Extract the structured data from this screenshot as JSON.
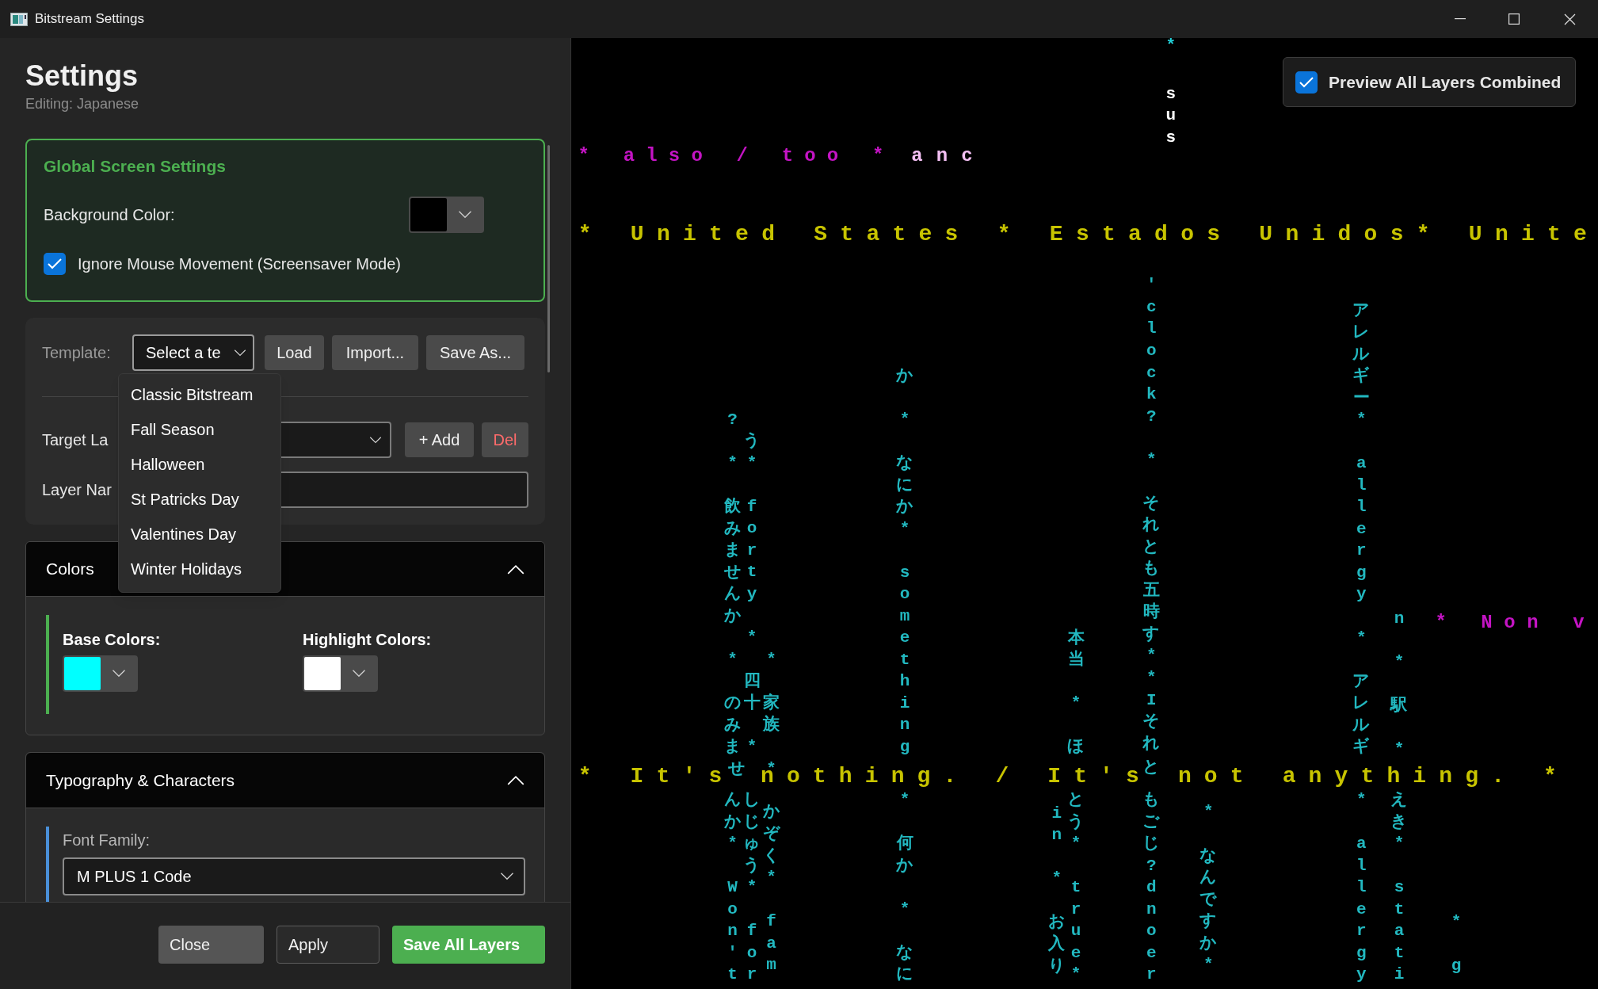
{
  "window": {
    "title": "Bitstream Settings"
  },
  "settings": {
    "heading": "Settings",
    "subtitle": "Editing: Japanese",
    "global": {
      "title": "Global Screen Settings",
      "background": {
        "label": "Background Color:",
        "color": "#000000"
      },
      "ignore_mouse": {
        "label": "Ignore Mouse Movement (Screensaver Mode)",
        "checked": true
      }
    },
    "template": {
      "label": "Template:",
      "value": "Select a te",
      "expanded": true,
      "buttons": [
        "Load",
        "Import...",
        "Save As..."
      ],
      "options": [
        "Classic Bitstream",
        "Fall Season",
        "Halloween",
        "St Patricks Day",
        "Valentines Day",
        "Winter Holidays"
      ]
    },
    "target_layer": {
      "label": "Target La",
      "buttons": [
        {
          "label": "+ Add",
          "kind": "normal"
        },
        {
          "label": "Del",
          "kind": "danger"
        }
      ]
    },
    "layer_name": {
      "label": "Layer Nar"
    },
    "colors": {
      "title": "Colors",
      "expanded": true,
      "pickers": [
        {
          "label": "Base Colors:",
          "color": "#00ffff"
        },
        {
          "label": "Highlight Colors:",
          "color": "#ffffff"
        }
      ]
    },
    "typography": {
      "title": "Typography & Characters",
      "expanded": true,
      "font_family": {
        "label": "Font Family:",
        "value": "M PLUS 1 Code"
      }
    }
  },
  "footer_buttons": [
    {
      "label": "Close",
      "kind": "secondary"
    },
    {
      "label": "Apply",
      "kind": "outline"
    },
    {
      "label": "Save All Layers",
      "kind": "primary"
    }
  ],
  "preview": {
    "combine_toggle": {
      "label": "Preview All Layers Combined",
      "checked": true
    },
    "streams": [
      {
        "kind": "vertical",
        "text": "*",
        "color": "#22d0d8"
      },
      {
        "kind": "vertical",
        "text": "sus",
        "color": "#ffffff"
      },
      {
        "kind": "horizontal",
        "text": "* also / too *",
        "color": "#c414c4"
      },
      {
        "kind": "horizontal",
        "text": "anc",
        "color": "#f4c0f4"
      },
      {
        "kind": "horizontal",
        "text": "* United States * Estados Unidos* Unite",
        "color": "#c8c400"
      },
      {
        "kind": "vertical",
        "text": "? * 飲みませんか * のみま",
        "color": "#22b8c0"
      },
      {
        "kind": "vertical",
        "text": "う* forty * 四十 *",
        "color": "#22b8c0"
      },
      {
        "kind": "vertical",
        "text": "* 家族",
        "color": "#22b8c0"
      },
      {
        "kind": "vertical",
        "text": "か * なにか* something",
        "color": "#22b8c0"
      },
      {
        "kind": "vertical",
        "text": "本当 * ほ",
        "color": "#22b8c0"
      },
      {
        "kind": "vertical",
        "text": "'clock? * それとも五時す**Iそれ",
        "color": "#22b8c0"
      },
      {
        "kind": "vertical",
        "text": "アレルギー* allergy * アレルギ",
        "color": "#22b8c0"
      },
      {
        "kind": "vertical",
        "text": "n * 駅 *",
        "color": "#22b8c0"
      },
      {
        "kind": "horizontal",
        "text": "* Non v",
        "color": "#c414c4"
      },
      {
        "kind": "horizontal",
        "text": "* It's",
        "color": "#c8c400"
      },
      {
        "kind": "vertical",
        "text": "せ",
        "color": "#22b8c0"
      },
      {
        "kind": "vertical",
        "text": "*",
        "color": "#22b8c0"
      },
      {
        "kind": "horizontal",
        "text": "nothing. / It's not anything. *",
        "color": "#c8c400"
      },
      {
        "kind": "vertical",
        "text": "と",
        "color": "#22b8c0"
      },
      {
        "kind": "vertical",
        "text": "んか* Won't",
        "color": "#22b8c0"
      },
      {
        "kind": "vertical",
        "text": "しじゅう* for",
        "color": "#22b8c0"
      },
      {
        "kind": "vertical",
        "text": "かぞく* fam",
        "color": "#22b8c0"
      },
      {
        "kind": "vertical",
        "text": "* 何か * なに",
        "color": "#22b8c0"
      },
      {
        "kind": "vertical",
        "text": "in * お入り",
        "color": "#22b8c0"
      },
      {
        "kind": "vertical",
        "text": "とう* true*",
        "color": "#22b8c0"
      },
      {
        "kind": "vertical",
        "text": "もごじ?dnoer",
        "color": "#22b8c0"
      },
      {
        "kind": "vertical",
        "text": "* なんですか*",
        "color": "#22b8c0"
      },
      {
        "kind": "vertical",
        "text": "* allergy",
        "color": "#22b8c0"
      },
      {
        "kind": "vertical",
        "text": "えき* stati",
        "color": "#22b8c0"
      },
      {
        "kind": "vertical",
        "text": "* g",
        "color": "#22b8c0"
      }
    ]
  }
}
